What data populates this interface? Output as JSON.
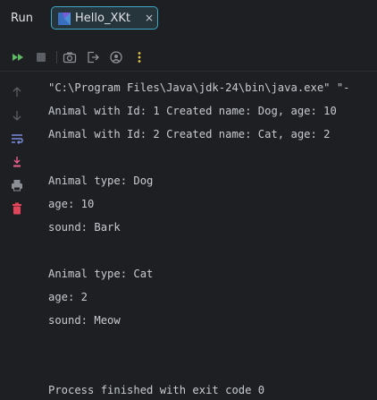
{
  "header": {
    "run_label": "Run",
    "tab": {
      "label": "Hello_XKt",
      "icon": "kotlin-file-icon",
      "close_glyph": "×"
    }
  },
  "toolbar": {
    "buttons": [
      {
        "name": "rerun-icon"
      },
      {
        "name": "stop-icon"
      },
      {
        "name": "camera-icon"
      },
      {
        "name": "exit-icon"
      },
      {
        "name": "settings-icon"
      },
      {
        "name": "more-options-icon"
      }
    ]
  },
  "gutter": {
    "buttons": [
      {
        "name": "arrow-up-icon"
      },
      {
        "name": "arrow-down-icon"
      },
      {
        "name": "soft-wrap-icon"
      },
      {
        "name": "scroll-to-end-icon"
      },
      {
        "name": "print-icon"
      },
      {
        "name": "trash-icon"
      }
    ]
  },
  "console": {
    "lines": [
      "\"C:\\Program Files\\Java\\jdk-24\\bin\\java.exe\" \"-",
      "Animal with Id: 1 Created name: Dog, age: 10",
      "Animal with Id: 2 Created name: Cat, age: 2",
      "",
      "Animal type: Dog",
      "age: 10",
      "sound: Bark",
      "",
      "Animal type: Cat",
      "age: 2",
      "sound: Meow",
      "",
      "",
      "Process finished with exit code 0"
    ]
  },
  "colors": {
    "background": "#1e1f22",
    "tab_border": "#3fa8c4",
    "rerun_green": "#5fb865",
    "more_yellow": "#e6c04a",
    "scroll_end_pink": "#e8608a",
    "trash_red": "#e0455a",
    "text": "#c7cbd1"
  }
}
